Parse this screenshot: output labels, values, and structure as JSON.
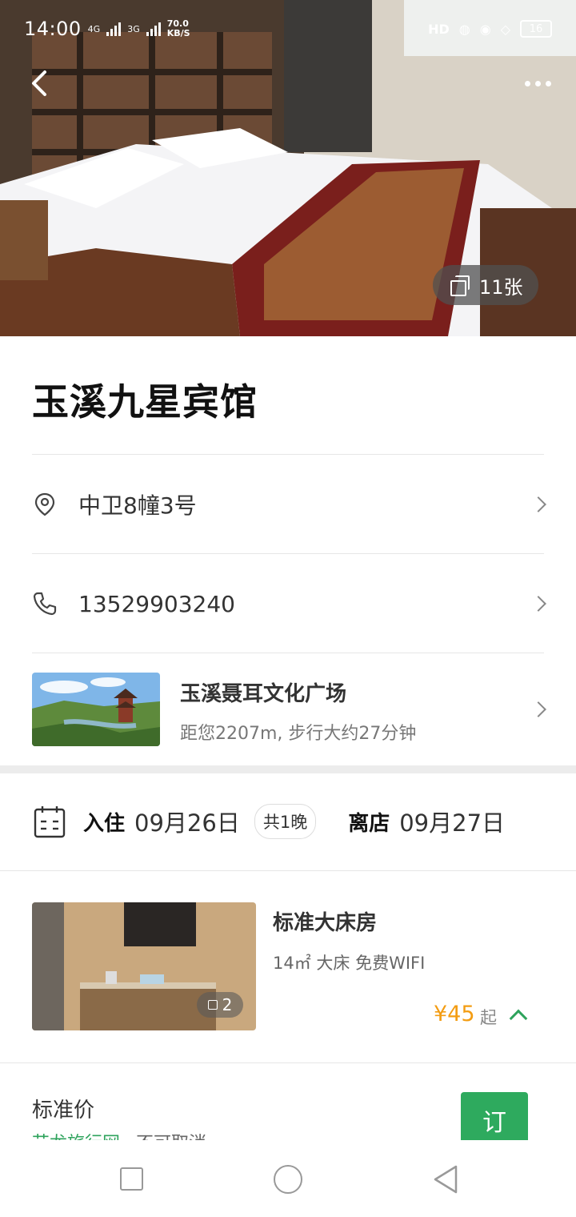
{
  "status_bar": {
    "time": "14:00",
    "net_a": "4G",
    "net_b": "3G",
    "speed_value": "70.0",
    "speed_unit": "KB/S",
    "hd": "HD",
    "battery": "16"
  },
  "hero": {
    "photo_count": "11张"
  },
  "hotel": {
    "name": "玉溪九星宾馆",
    "address": "中卫8幢3号",
    "phone": "13529903240"
  },
  "poi": {
    "name": "玉溪聂耳文化广场",
    "distance": "距您2207m, 步行大约27分钟"
  },
  "stay": {
    "checkin_label": "入住",
    "checkin_date": "09月26日",
    "nights": "共1晚",
    "checkout_label": "离店",
    "checkout_date": "09月27日"
  },
  "room": {
    "name": "标准大床房",
    "desc": "14㎡ 大床 免费WIFI",
    "image_count": "2",
    "price": "¥45",
    "price_suffix": "起"
  },
  "rate_plan": {
    "title": "标准价",
    "source": "艺龙旅行网",
    "policy": "不可取消",
    "book_label": "订"
  },
  "colors": {
    "accent_green": "#2eaa5e",
    "price_orange": "#f39c12"
  }
}
